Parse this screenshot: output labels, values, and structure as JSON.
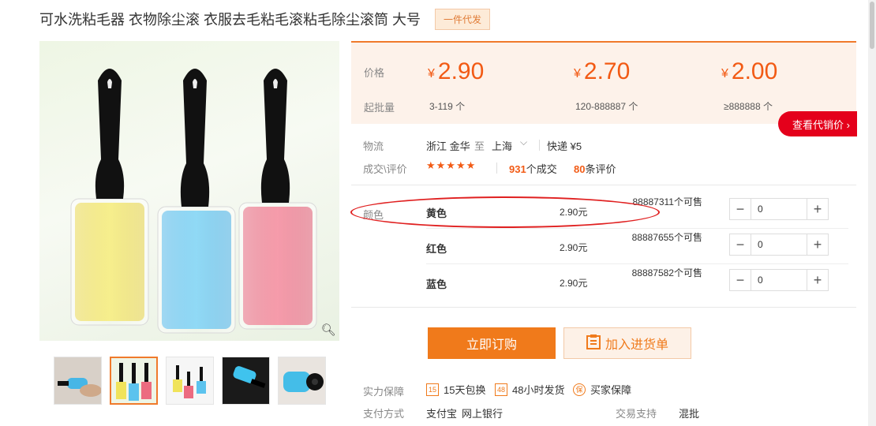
{
  "product": {
    "title": "可水洗粘毛器 衣物除尘滚 衣服去毛粘毛滚粘毛除尘滚筒 大号",
    "tag": "一件代发"
  },
  "price_box": {
    "price_label": "价格",
    "moq_label": "起批量",
    "tiers": [
      {
        "currency": "¥",
        "price": "2.90",
        "moq": "3-119 个"
      },
      {
        "currency": "¥",
        "price": "2.70",
        "moq": "120-888887 个"
      },
      {
        "currency": "¥",
        "price": "2.00",
        "moq": "≥888888 个"
      }
    ],
    "agent_price_button": "查看代销价 ›"
  },
  "logistics": {
    "label": "物流",
    "from": "浙江 金华",
    "to_word": "至",
    "to": "上海",
    "shipping": "快递 ¥5"
  },
  "trade": {
    "label": "成交\\评价",
    "stars": "★★★★★",
    "rating": 4.5,
    "deals_count": "931",
    "deals_suffix": "个成交",
    "reviews_count": "80",
    "reviews_suffix": "条评价"
  },
  "sku": {
    "label": "颜色",
    "rows": [
      {
        "name": "黄色",
        "price": "2.90元",
        "stock": "88887311个可售",
        "qty": "0"
      },
      {
        "name": "红色",
        "price": "2.90元",
        "stock": "88887655个可售",
        "qty": "0"
      },
      {
        "name": "蓝色",
        "price": "2.90元",
        "stock": "88887582个可售",
        "qty": "0"
      }
    ]
  },
  "actions": {
    "buy_now": "立即订购",
    "add_to_list": "加入进货单"
  },
  "guarantee": {
    "label": "实力保障",
    "items": [
      {
        "icon": "15",
        "text": "15天包换"
      },
      {
        "icon": "48",
        "text": "48小时发货"
      },
      {
        "icon": "保",
        "text": "买家保障"
      }
    ]
  },
  "payment": {
    "label": "支付方式",
    "methods": [
      "支付宝",
      "网上银行"
    ],
    "trade_support_label": "交易支持",
    "trade_support_value": "混批"
  },
  "colors": {
    "accent": "#f07a1b",
    "price": "#f25a14",
    "agent_btn": "#e4001b",
    "annotation": "#e02020",
    "roller_yellow": "#f0e35a",
    "roller_blue": "#5cc3ee",
    "roller_pink": "#ec6b80"
  }
}
